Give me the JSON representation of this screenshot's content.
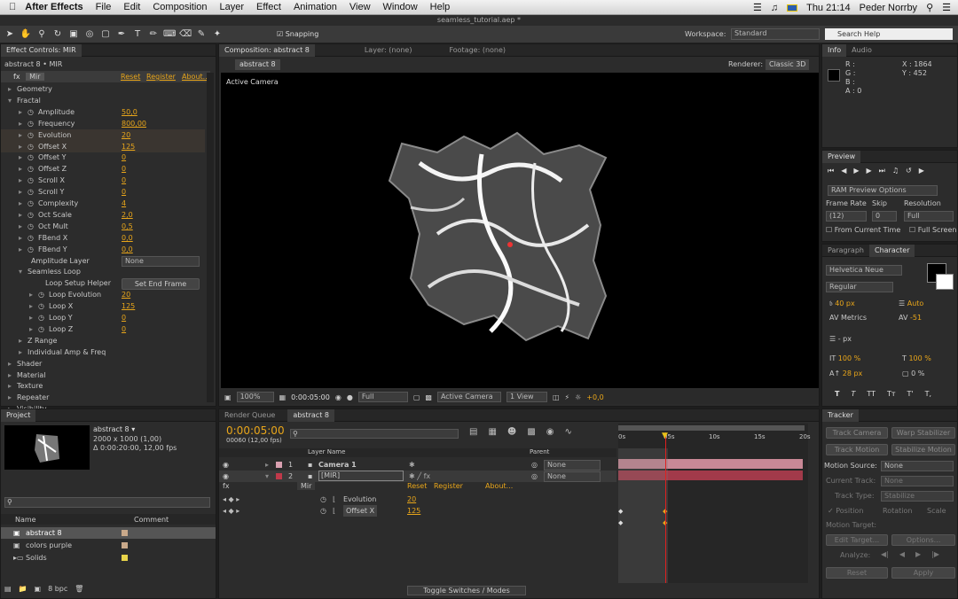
{
  "menubar": {
    "app": "After Effects",
    "items": [
      "File",
      "Edit",
      "Composition",
      "Layer",
      "Effect",
      "Animation",
      "View",
      "Window",
      "Help"
    ],
    "clock": "Thu 21:14",
    "user": "Peder Norrby"
  },
  "window_title": "seamless_tutorial.aep *",
  "toolbar": {
    "snapping": "Snapping",
    "workspace_label": "Workspace:",
    "workspace_value": "Standard",
    "search_placeholder": "Search Help"
  },
  "effect_controls": {
    "tab": "Effect Controls: MIR",
    "breadcrumb": "abstract 8 • MIR",
    "effect_name": "Mir",
    "reset": "Reset",
    "register": "Register",
    "about": "About...",
    "rows": [
      {
        "label": "Geometry",
        "value": ""
      },
      {
        "label": "Fractal",
        "value": ""
      },
      {
        "label": "Amplitude",
        "value": "50,0"
      },
      {
        "label": "Frequency",
        "value": "800,00"
      },
      {
        "label": "Evolution",
        "value": "20"
      },
      {
        "label": "Offset X",
        "value": "125"
      },
      {
        "label": "Offset Y",
        "value": "0"
      },
      {
        "label": "Offset Z",
        "value": "0"
      },
      {
        "label": "Scroll X",
        "value": "0"
      },
      {
        "label": "Scroll Y",
        "value": "0"
      },
      {
        "label": "Complexity",
        "value": "4"
      },
      {
        "label": "Oct Scale",
        "value": "2,0"
      },
      {
        "label": "Oct Mult",
        "value": "0,5"
      },
      {
        "label": "FBend X",
        "value": "0,0"
      },
      {
        "label": "FBend Y",
        "value": "0,0"
      },
      {
        "label": "Amplitude Layer",
        "value": "None"
      },
      {
        "label": "Seamless Loop",
        "value": ""
      },
      {
        "label": "Loop Setup Helper",
        "value": "Set End Frame"
      },
      {
        "label": "Loop Evolution",
        "value": "20"
      },
      {
        "label": "Loop X",
        "value": "125"
      },
      {
        "label": "Loop Y",
        "value": "0"
      },
      {
        "label": "Loop Z",
        "value": "0"
      },
      {
        "label": "Z Range",
        "value": ""
      },
      {
        "label": "Individual Amp & Freq",
        "value": ""
      },
      {
        "label": "Shader",
        "value": ""
      },
      {
        "label": "Material",
        "value": ""
      },
      {
        "label": "Texture",
        "value": ""
      },
      {
        "label": "Repeater",
        "value": ""
      },
      {
        "label": "Visibility",
        "value": ""
      }
    ]
  },
  "composition": {
    "tab": "Composition: abstract 8",
    "layer_tab": "Layer: (none)",
    "footage_tab": "Footage: (none)",
    "comp_name": "abstract 8",
    "renderer_label": "Renderer:",
    "renderer_value": "Classic 3D",
    "view_label": "Active Camera",
    "zoom": "100%",
    "time": "0:00:05:00",
    "quality": "Full",
    "camera": "Active Camera",
    "views": "1 View",
    "exposure": "+0,0"
  },
  "info": {
    "tab": "Info",
    "audio_tab": "Audio",
    "r": "R :",
    "g": "G :",
    "b": "B :",
    "a": "A : 0",
    "x": "X : 1864",
    "y": "Y : 452"
  },
  "preview": {
    "tab": "Preview",
    "ram": "RAM Preview Options",
    "frame_rate_label": "Frame Rate",
    "skip_label": "Skip",
    "resolution_label": "Resolution",
    "frame_rate": "(12)",
    "skip": "0",
    "resolution": "Full",
    "from_current": "From Current Time",
    "full_screen": "Full Screen"
  },
  "character": {
    "paragraph_tab": "Paragraph",
    "tab": "Character",
    "font": "Helvetica Neue",
    "style": "Regular",
    "size": "40 px",
    "leading": "Auto",
    "kerning": "Metrics",
    "tracking": "-51",
    "stroke": "- px",
    "vscale": "100 %",
    "hscale": "100 %",
    "baseline": "28 px",
    "tsume": "0 %",
    "styles": [
      "T",
      "T",
      "TT",
      "Tт",
      "T'",
      "T,"
    ]
  },
  "project": {
    "tab": "Project",
    "name": "abstract 8 ▾",
    "dims": "2000 x 1000 (1,00)",
    "dur": "Δ 0:00:20:00, 12,00 fps",
    "col_name": "Name",
    "col_comment": "Comment",
    "items": [
      {
        "name": "abstract 8",
        "color": "#c9a98a"
      },
      {
        "name": "colors purple",
        "color": "#c9a98a"
      },
      {
        "name": "Solids",
        "color": "#e8d44a"
      }
    ],
    "bpc": "8 bpc"
  },
  "timeline": {
    "render_tab": "Render Queue",
    "tab": "abstract 8",
    "time": "0:00:05:00",
    "frames": "00060 (12,00 fps)",
    "layer_name_col": "Layer Name",
    "parent_col": "Parent",
    "layers": [
      {
        "num": "1",
        "name": "Camera 1",
        "parent": "None",
        "color": "#d9a0b0"
      },
      {
        "num": "2",
        "name": "[MIR]",
        "parent": "None",
        "color": "#c0394a"
      }
    ],
    "effect": "Mir",
    "reset": "Reset",
    "register": "Register",
    "about": "About...",
    "props": [
      {
        "name": "Evolution",
        "value": "20"
      },
      {
        "name": "Offset X",
        "value": "125"
      }
    ],
    "ruler": [
      "0s",
      "05s",
      "10s",
      "15s",
      "20s"
    ],
    "toggle": "Toggle Switches / Modes"
  },
  "tracker": {
    "tab": "Tracker",
    "track_camera": "Track Camera",
    "warp": "Warp Stabilizer",
    "track_motion": "Track Motion",
    "stabilize": "Stabilize Motion",
    "motion_source_label": "Motion Source:",
    "motion_source": "None",
    "current_track_label": "Current Track:",
    "current_track": "None",
    "track_type_label": "Track Type:",
    "track_type": "Stabilize",
    "position": "Position",
    "rotation": "Rotation",
    "scale": "Scale",
    "motion_target": "Motion Target:",
    "edit_target": "Edit Target...",
    "options": "Options...",
    "analyze": "Analyze:",
    "reset": "Reset",
    "apply": "Apply"
  }
}
